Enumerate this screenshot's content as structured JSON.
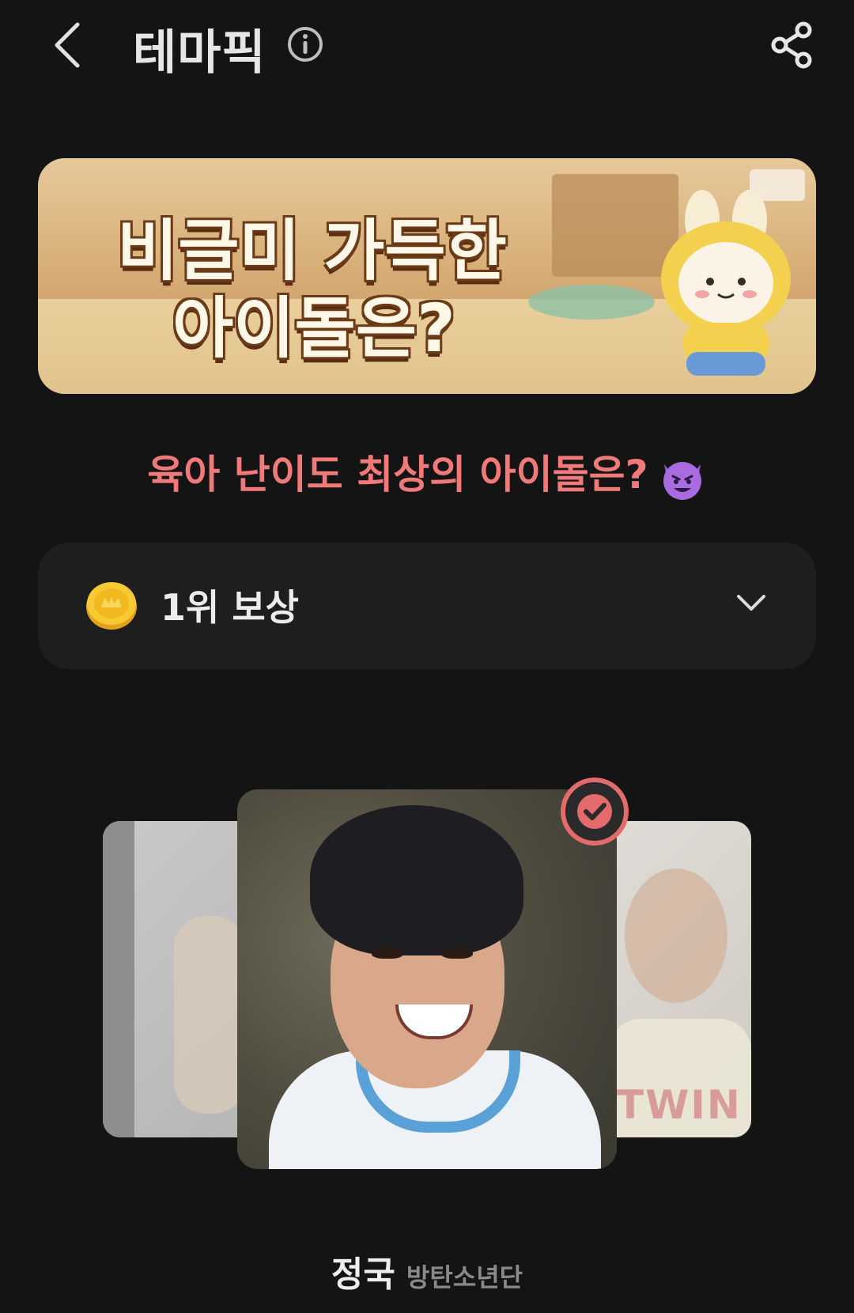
{
  "header": {
    "title": "테마픽",
    "back_icon": "chevron-left-icon",
    "info_icon": "info-icon",
    "share_icon": "share-icon"
  },
  "banner": {
    "line1": "비글미 가득한",
    "line2": "아이돌은?"
  },
  "question": {
    "text": "육아 난이도 최상의 아이돌은?",
    "emoji_icon": "smiling-devil-icon"
  },
  "reward": {
    "label": "1위 보상",
    "coin_icon": "gold-coin-icon",
    "expand_icon": "chevron-down-icon"
  },
  "carousel": {
    "side_right_text": "TWIN",
    "selected_check_icon": "check-circle-icon"
  },
  "selection": {
    "name": "정국",
    "group": "방탄소년단"
  },
  "colors": {
    "background": "#141414",
    "accent": "#f07a7a",
    "panel": "#1e1e1e"
  }
}
